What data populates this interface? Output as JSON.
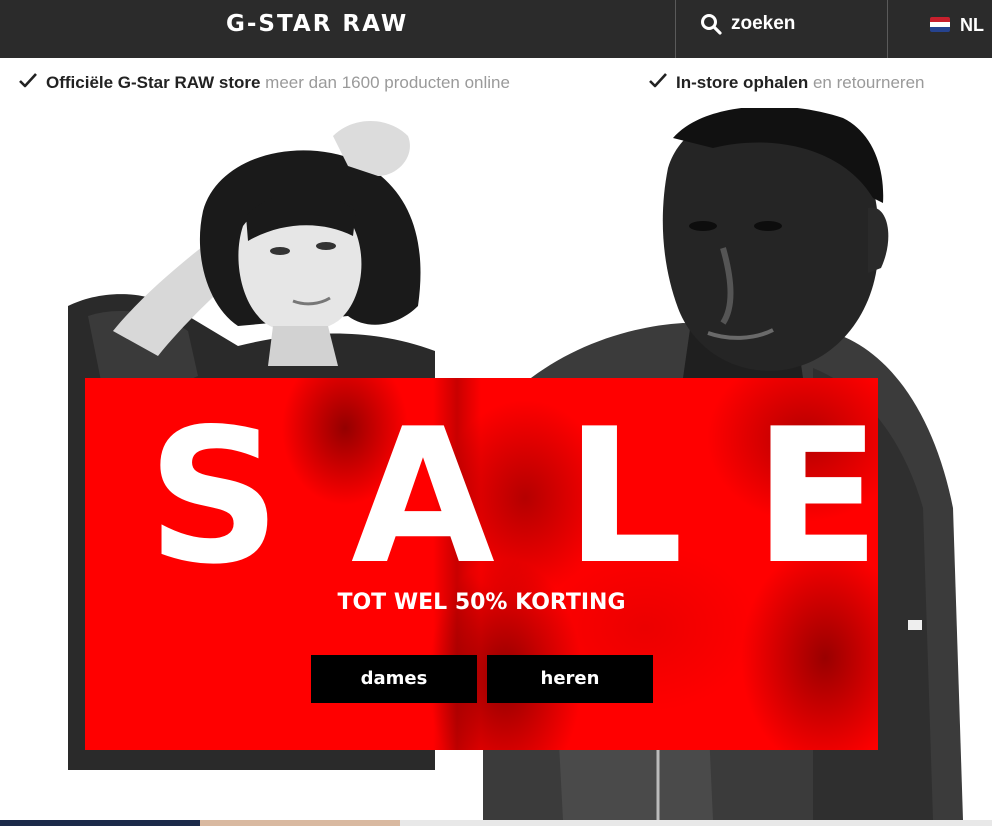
{
  "header": {
    "logo_text": "G-STAR RAW",
    "search_label": "zoeken",
    "search_icon": "search-icon",
    "language_label": "NL",
    "language_flag": "netherlands-flag-icon",
    "background_color": "#2b2b2b"
  },
  "usp_bar": {
    "items": [
      {
        "icon": "checkmark-icon",
        "strong": "Officiële G-Star RAW store",
        "light": "meer dan 1600 producten online"
      },
      {
        "icon": "checkmark-icon",
        "strong": "In-store ophalen",
        "light": "en retourneren"
      }
    ]
  },
  "hero": {
    "sale_title": "SALE",
    "sale_subtitle": "TOT WEL 50% KORTING",
    "buttons": [
      {
        "label": "dames"
      },
      {
        "label": "heren"
      }
    ],
    "panel_color": "#ff0000",
    "button_color": "#000000"
  }
}
